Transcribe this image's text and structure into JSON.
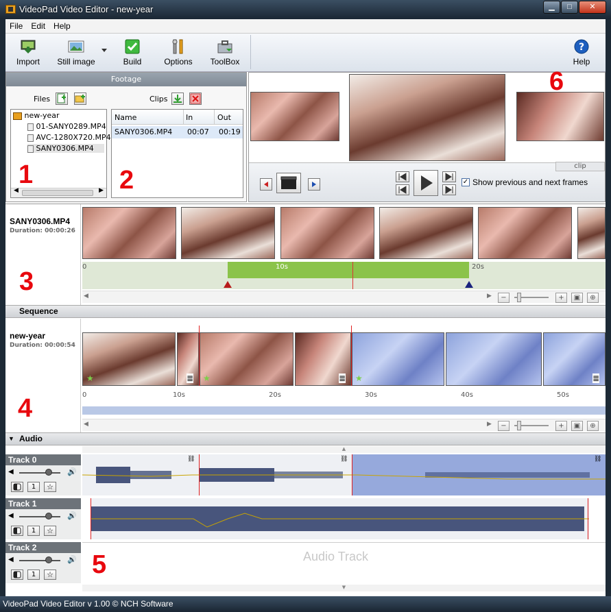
{
  "window": {
    "title": "VideoPad Video Editor - new-year",
    "minimize": "▁",
    "maximize": "□",
    "close": "✕"
  },
  "menu": [
    "File",
    "Edit",
    "Help"
  ],
  "toolbar": {
    "import": "Import",
    "still_image": "Still image",
    "build": "Build",
    "options": "Options",
    "toolbox": "ToolBox",
    "help": "Help"
  },
  "footage": {
    "header": "Footage",
    "files_label": "Files",
    "clips_label": "Clips",
    "tree": {
      "root": "new-year",
      "files": [
        "01-SANY0289.MP4",
        "AVC-1280X720.MP4",
        "SANY0306.MP4"
      ]
    },
    "clips_table": {
      "columns": [
        "Name",
        "In",
        "Out"
      ],
      "rows": [
        [
          "SANY0306.MP4",
          "00:07",
          "00:19"
        ]
      ]
    }
  },
  "preview": {
    "tab_label": "clip",
    "show_frames_label": "Show previous and next frames",
    "show_frames_checked": true
  },
  "clip_panel": {
    "name": "SANY0306.MP4",
    "duration": "Duration: 00:00:26",
    "ruler": [
      "0",
      "10s",
      "20s"
    ]
  },
  "sequence": {
    "header": "Sequence",
    "name": "new-year",
    "duration": "Duration: 00:00:54",
    "ruler": [
      "0",
      "10s",
      "20s",
      "30s",
      "40s",
      "50s"
    ]
  },
  "audio": {
    "header": "Audio",
    "tracks": [
      "Track 0",
      "Track 1",
      "Track 2"
    ],
    "empty_track_label": "Audio Track",
    "btn_one": "1"
  },
  "annotations": [
    "1",
    "2",
    "3",
    "4",
    "5",
    "6"
  ],
  "status": "VideoPad Video Editor v 1.00 © NCH Software",
  "colors": {
    "accent_red": "#e8080e",
    "selection_green": "#8bc34a",
    "selection_blue": "#8da3dc",
    "waveform": "#2a3a66"
  }
}
